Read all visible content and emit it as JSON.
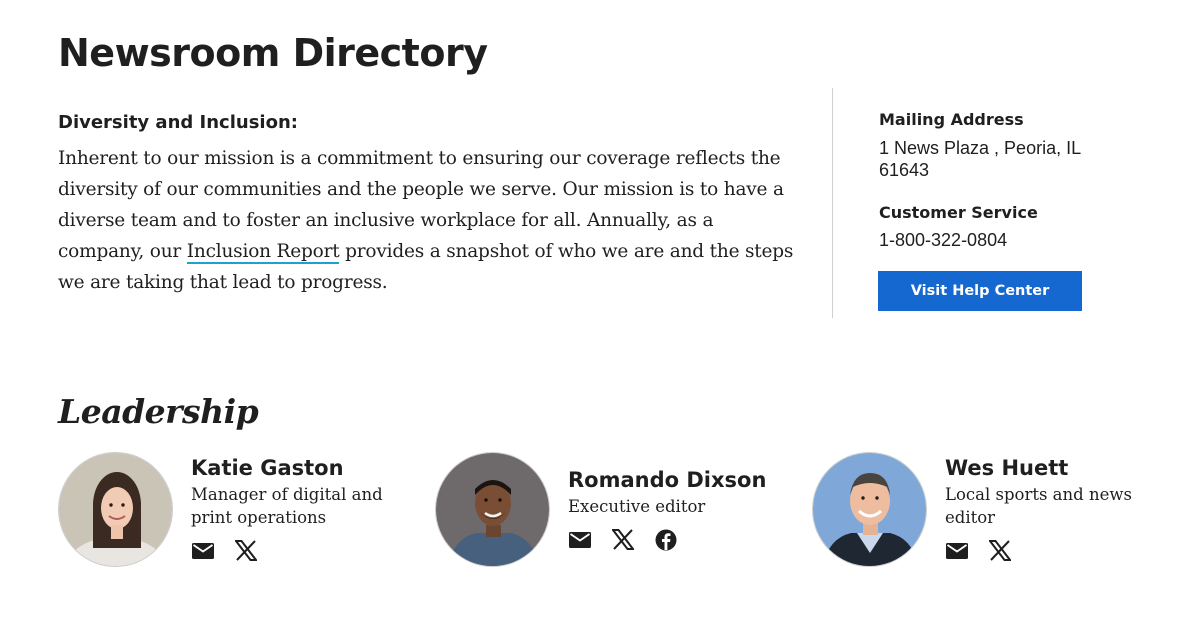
{
  "page": {
    "title": "Newsroom Directory"
  },
  "diversity": {
    "heading": "Diversity and Inclusion:",
    "text_before": "Inherent to our mission is a commitment to ensuring our coverage reflects the diversity of our communities and the people we serve. Our mission is to have a diverse team and to foster an inclusive workplace for all. Annually, as a company, our ",
    "link_label": "Inclusion Report",
    "text_after": " provides a snapshot of who we are and the steps we are taking that lead to progress."
  },
  "sidebar": {
    "mailing_label": "Mailing Address",
    "mailing_value": "1 News Plaza , Peoria, IL 61643",
    "service_label": "Customer Service",
    "service_value": "1-800-322-0804",
    "help_button_label": "Visit Help Center",
    "help_button_color": "#1568d0"
  },
  "leadership": {
    "title": "Leadership",
    "people": [
      {
        "name": "Katie Gaston",
        "role": "Manager of digital and print operations",
        "icons": [
          "email-icon",
          "x-twitter-icon"
        ]
      },
      {
        "name": "Romando Dixson",
        "role": "Executive editor",
        "icons": [
          "email-icon",
          "x-twitter-icon",
          "facebook-icon"
        ]
      },
      {
        "name": "Wes Huett",
        "role": "Local sports and news editor",
        "icons": [
          "email-icon",
          "x-twitter-icon"
        ]
      }
    ]
  },
  "colors": {
    "link_underline": "#1ea0d2",
    "text": "#1f1f1f",
    "divider": "#d0d0d0"
  }
}
